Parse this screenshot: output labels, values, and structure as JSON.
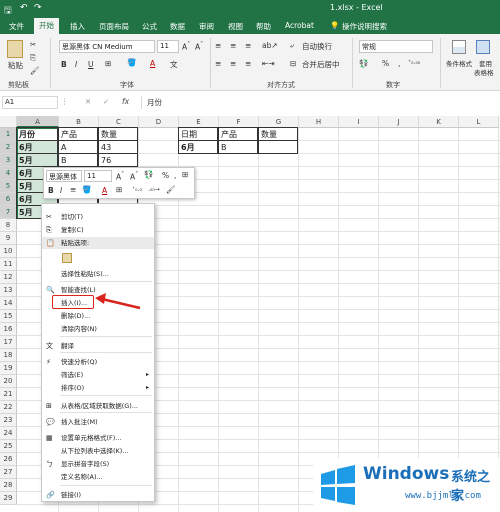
{
  "title_bar": {
    "title": "1.xlsx - Excel",
    "search": "操作说明搜索"
  },
  "tabs": [
    "文件",
    "开始",
    "插入",
    "页面布局",
    "公式",
    "数据",
    "审阅",
    "视图",
    "帮助",
    "Acrobat"
  ],
  "active_tab": "开始",
  "ribbon": {
    "paste": "粘贴",
    "clipboard": "剪贴板",
    "font_name": "思源黑体 CN Medium",
    "font_size": "11",
    "font_group": "字体",
    "wrap": "自动换行",
    "merge": "合并后居中",
    "align_group": "对齐方式",
    "number_format": "常规",
    "number_group": "数字",
    "cond_format": "条件格式",
    "table_format": "套用\n表格格式",
    "right_cut": "单"
  },
  "formula_bar": {
    "name_box": "A1",
    "fx": "fx",
    "content": "月份"
  },
  "columns": [
    "A",
    "B",
    "C",
    "D",
    "E",
    "F",
    "G",
    "H",
    "I",
    "J",
    "K",
    "L"
  ],
  "rows": [
    "1",
    "2",
    "3",
    "4",
    "5",
    "6",
    "7",
    "8",
    "9",
    "10",
    "11",
    "12",
    "13",
    "14",
    "15",
    "16",
    "17",
    "18",
    "19",
    "20",
    "21",
    "22",
    "23",
    "24",
    "25",
    "26",
    "27",
    "28",
    "29"
  ],
  "cells": {
    "A1": "月份",
    "B1": "产品",
    "C1": "数量",
    "A2": "6月",
    "B2": "A",
    "C2": "43",
    "A3": "5月",
    "B3": "B",
    "C3": "76",
    "A4": "6月",
    "A5": "5月",
    "A6": "6月",
    "A7": "5月",
    "E1": "日期",
    "F1": "产品",
    "G1": "数量",
    "E2": "6月",
    "F2": "B"
  },
  "mini_toolbar": {
    "font": "思源黑体",
    "size": "11",
    "percent": "%",
    "comma": ","
  },
  "context_menu": [
    {
      "label": "剪切(T)",
      "icon": "scissors-icon"
    },
    {
      "label": "复制(C)",
      "icon": "copy-icon"
    },
    {
      "label": "粘贴选项:",
      "icon": "paste-icon"
    },
    {
      "label": "",
      "icon": "paste-option-icon"
    },
    {
      "label": "选择性粘贴(S)...",
      "icon": ""
    },
    {
      "label": "智能查找(L)",
      "icon": "smart-lookup-icon"
    },
    {
      "label": "插入(I)...",
      "icon": ""
    },
    {
      "label": "删除(D)...",
      "icon": ""
    },
    {
      "label": "清除内容(N)",
      "icon": ""
    },
    {
      "label": "翻译",
      "icon": "translate-icon"
    },
    {
      "label": "快速分析(Q)",
      "icon": "quick-analysis-icon"
    },
    {
      "label": "筛选(E)",
      "icon": ""
    },
    {
      "label": "排序(O)",
      "icon": ""
    },
    {
      "label": "从表格/区域获取数据(G)...",
      "icon": "table-icon"
    },
    {
      "label": "插入批注(M)",
      "icon": "comment-icon"
    },
    {
      "label": "设置单元格格式(F)...",
      "icon": "format-cells-icon"
    },
    {
      "label": "从下拉列表中选择(K)...",
      "icon": ""
    },
    {
      "label": "显示拼音字段(S)",
      "icon": "phonetic-icon"
    },
    {
      "label": "定义名称(A)...",
      "icon": ""
    },
    {
      "label": "链接(I)",
      "icon": "link-icon"
    }
  ],
  "watermark": {
    "brand": "Windows",
    "cn": "系统之家",
    "url": "www.bjjmlv.com"
  },
  "colors": {
    "excel_green": "#217346",
    "selection": "#d2e7d9",
    "annotation_red": "#d9231c"
  }
}
